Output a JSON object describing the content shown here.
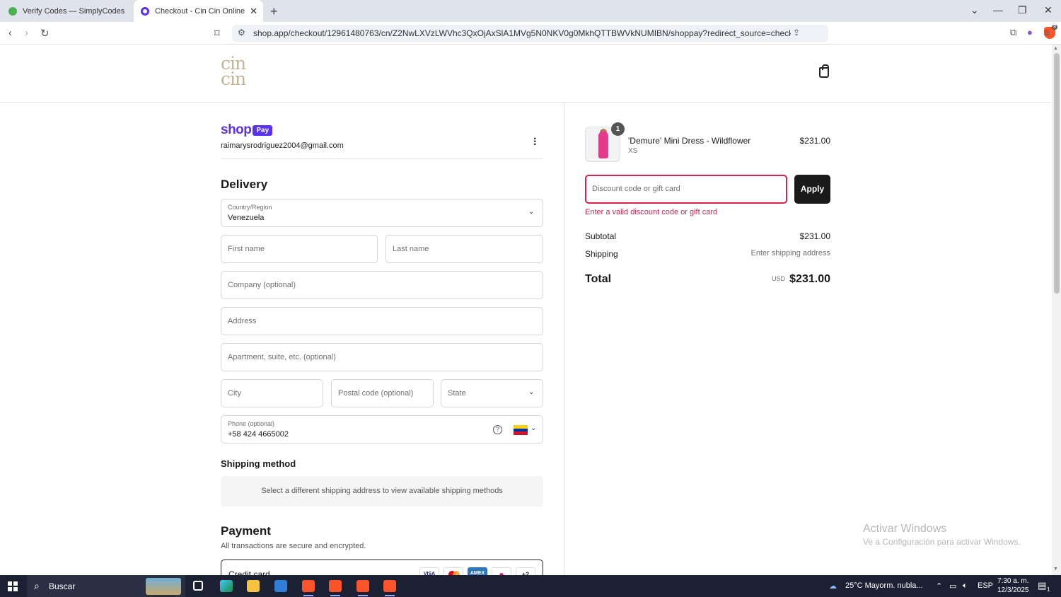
{
  "browser": {
    "tabs": [
      {
        "title": "Verify Codes — SimplyCodes",
        "active": false
      },
      {
        "title": "Checkout - Cin Cin Online",
        "active": true
      }
    ],
    "url": "shop.app/checkout/12961480763/cn/Z2NwLXVzLWVhc3QxOjAxSlA1MVg5N0NKV0g0MkhQTTBWVkNUMIBN/shoppay?redirect_source=checkout_universa...",
    "brave_badge": "8"
  },
  "store": {
    "logo_line1": "cin",
    "logo_line2": "cin"
  },
  "account": {
    "shop_word": "shop",
    "pay_word": "Pay",
    "email": "raimarysrodriguez2004@gmail.com"
  },
  "delivery": {
    "heading": "Delivery",
    "country_label": "Country/Region",
    "country_value": "Venezuela",
    "first_name_placeholder": "First name",
    "last_name_placeholder": "Last name",
    "company_placeholder": "Company (optional)",
    "address_placeholder": "Address",
    "apartment_placeholder": "Apartment, suite, etc. (optional)",
    "city_placeholder": "City",
    "postal_placeholder": "Postal code (optional)",
    "state_placeholder": "State",
    "phone_label": "Phone (optional)",
    "phone_value": "+58 424 4665002",
    "help_glyph": "?"
  },
  "shipping_method": {
    "heading": "Shipping method",
    "message": "Select a different shipping address to view available shipping methods"
  },
  "payment": {
    "heading": "Payment",
    "note": "All transactions are secure and encrypted.",
    "credit_card_label": "Credit card",
    "card_logos": [
      "VISA",
      "",
      "AMEX",
      "",
      "+2"
    ]
  },
  "summary": {
    "item": {
      "quantity": "1",
      "name": "'Demure' Mini Dress - Wildflower",
      "variant": "XS",
      "price": "$231.00"
    },
    "discount_placeholder": "Discount code or gift card",
    "apply_label": "Apply",
    "error_message": "Enter a valid discount code or gift card",
    "subtotal_label": "Subtotal",
    "subtotal_value": "$231.00",
    "shipping_label": "Shipping",
    "shipping_value": "Enter shipping address",
    "total_label": "Total",
    "currency": "USD",
    "total_value": "$231.00"
  },
  "watermark": {
    "line1": "Activar Windows",
    "line2": "Ve a Configuración para activar Windows."
  },
  "taskbar": {
    "search_text": "Buscar",
    "weather": "25°C  Mayorm. nubla...",
    "language": "ESP",
    "time": "7:30 a. m.",
    "date": "12/3/2025",
    "notification_count": "1"
  },
  "colors": {
    "shop_purple": "#5a31f4",
    "error_red": "#dd1d4a",
    "logo_beige": "#c6b393",
    "dress_pink": "#e33c8f"
  }
}
